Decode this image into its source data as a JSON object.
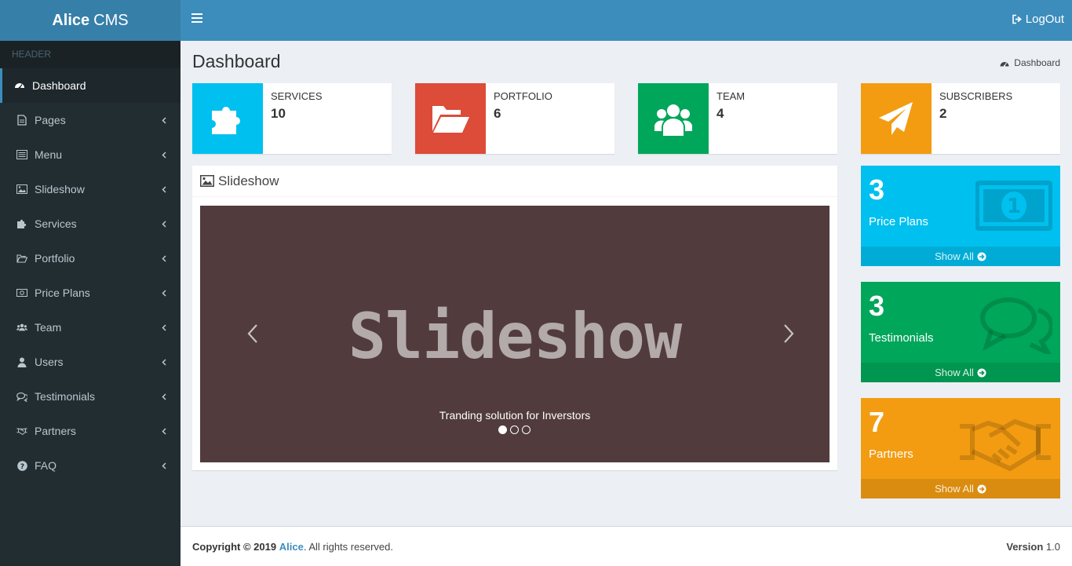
{
  "brand": {
    "bold": "Alice",
    "rest": "CMS"
  },
  "sidebar": {
    "header": "HEADER",
    "items": [
      {
        "label": "Dashboard",
        "icon": "dashboard-icon",
        "active": true
      },
      {
        "label": "Pages",
        "icon": "file-icon"
      },
      {
        "label": "Menu",
        "icon": "list-icon"
      },
      {
        "label": "Slideshow",
        "icon": "image-icon"
      },
      {
        "label": "Services",
        "icon": "puzzle-icon"
      },
      {
        "label": "Portfolio",
        "icon": "folder-open-icon"
      },
      {
        "label": "Price Plans",
        "icon": "money-icon"
      },
      {
        "label": "Team",
        "icon": "users-icon"
      },
      {
        "label": "Users",
        "icon": "user-icon"
      },
      {
        "label": "Testimonials",
        "icon": "comments-icon"
      },
      {
        "label": "Partners",
        "icon": "handshake-icon"
      },
      {
        "label": "FAQ",
        "icon": "question-icon"
      }
    ]
  },
  "topbar": {
    "logout": "LogOut"
  },
  "content": {
    "title": "Dashboard",
    "breadcrumb": "Dashboard"
  },
  "info_boxes": [
    {
      "label": "SERVICES",
      "number": "10",
      "color": "#00c0ef",
      "icon": "puzzle-icon"
    },
    {
      "label": "PORTFOLIO",
      "number": "6",
      "color": "#dd4b39",
      "icon": "folder-open-icon"
    },
    {
      "label": "TEAM",
      "number": "4",
      "color": "#00a65a",
      "icon": "users-icon"
    },
    {
      "label": "SUBSCRIBERS",
      "number": "2",
      "color": "#f39c12",
      "icon": "paper-plane-icon"
    }
  ],
  "slideshow": {
    "title": "Slideshow",
    "slide_text": "Slideshow",
    "caption": "Tranding solution for Inverstors",
    "slides": 3,
    "active_slide": 1
  },
  "small_boxes": [
    {
      "number": "3",
      "label": "Price Plans",
      "footer": "Show All",
      "color": "#00c0ef",
      "icon": "money-icon"
    },
    {
      "number": "3",
      "label": "Testimonials",
      "footer": "Show All",
      "color": "#00a65a",
      "icon": "comments-icon"
    },
    {
      "number": "7",
      "label": "Partners",
      "footer": "Show All",
      "color": "#f39c12",
      "icon": "handshake-icon"
    }
  ],
  "footer": {
    "copyright": "Copyright © 2019",
    "brand": "Alice",
    "rights": ". All rights reserved.",
    "version_label": "Version",
    "version": "1.0"
  }
}
